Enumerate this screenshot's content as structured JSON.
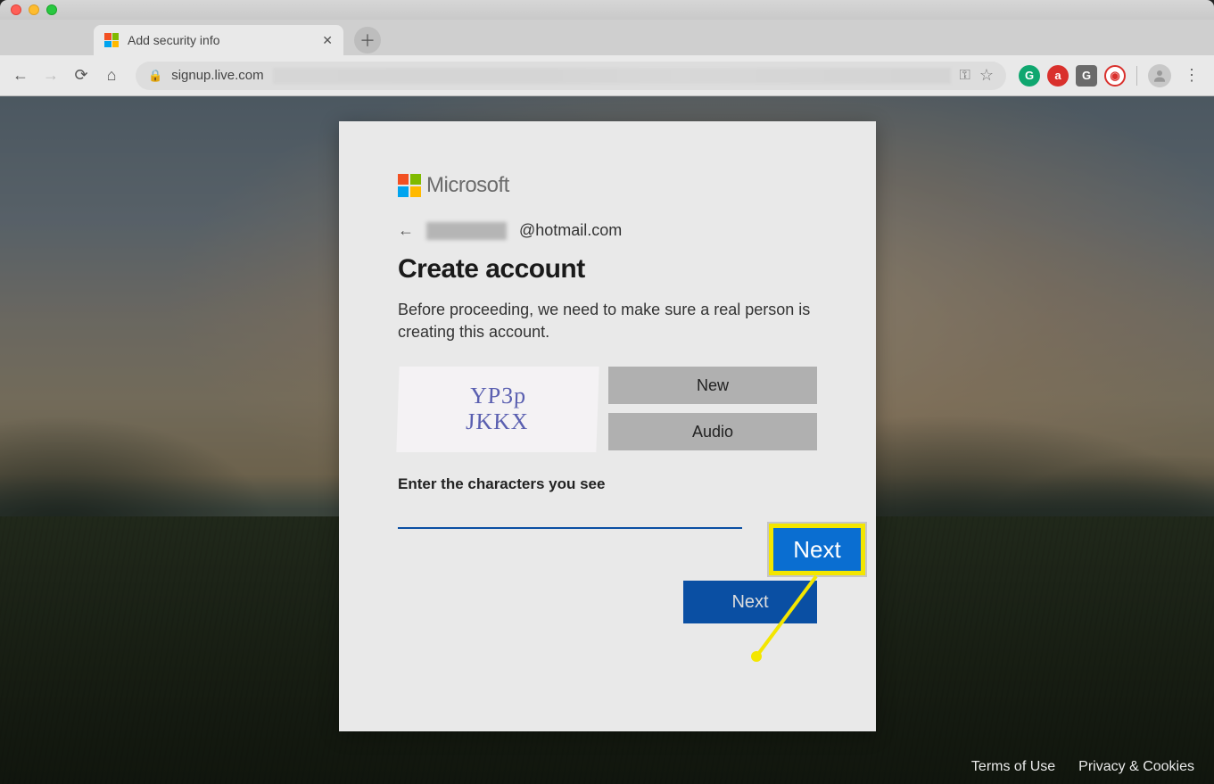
{
  "browser": {
    "tab_title": "Add security info",
    "url_host": "signup.live.com"
  },
  "card": {
    "brand": "Microsoft",
    "email_domain": "@hotmail.com",
    "heading": "Create account",
    "description": "Before proceeding, we need to make sure a real person is creating this account.",
    "captcha_new": "New",
    "captcha_audio": "Audio",
    "input_label": "Enter the characters you see",
    "next_button": "Next"
  },
  "callout": {
    "label": "Next"
  },
  "footer": {
    "terms": "Terms of Use",
    "privacy": "Privacy & Cookies"
  }
}
